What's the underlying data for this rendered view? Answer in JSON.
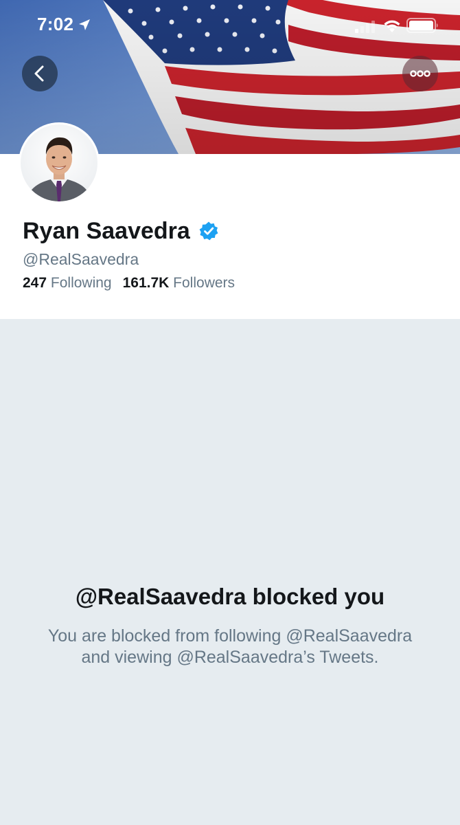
{
  "status_bar": {
    "time": "7:02"
  },
  "icons": {
    "location": "location-arrow-icon",
    "signal": "cellular-signal-icon",
    "wifi": "wifi-icon",
    "battery": "battery-icon",
    "back": "chevron-left-icon",
    "more": "more-options-icon",
    "verified": "verified-badge-icon"
  },
  "colors": {
    "verified_blue": "#1da1f2",
    "text_primary": "#14171a",
    "text_secondary": "#657786",
    "background": "#e6ecf0"
  },
  "profile": {
    "name": "Ryan Saavedra",
    "handle": "@RealSaavedra",
    "following_count": "247",
    "following_label": "Following",
    "followers_count": "161.7K",
    "followers_label": "Followers"
  },
  "blocked": {
    "title": "@RealSaavedra blocked you",
    "line1": "You are blocked from following @RealSaavedra",
    "line2": "and viewing @RealSaavedra’s Tweets."
  }
}
